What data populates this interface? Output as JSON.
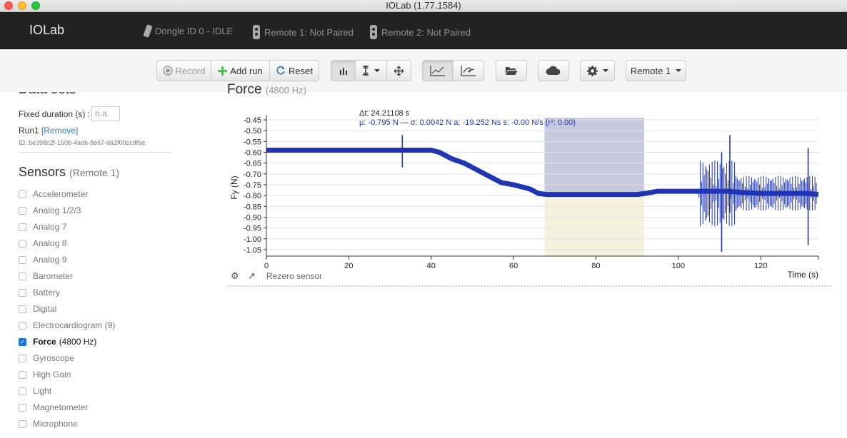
{
  "window": {
    "title": "IOLab (1.77.1584)"
  },
  "navbar": {
    "brand": "IOLab",
    "dongle": "Dongle ID 0 - IDLE",
    "remote1": "Remote 1: Not Paired",
    "remote2": "Remote 2: Not Paired"
  },
  "toolbar": {
    "record": "Record",
    "add_run": "Add run",
    "reset": "Reset",
    "remote_select": "Remote 1"
  },
  "sidebar": {
    "data_sets_title": "Data sets",
    "fixed_duration_label": "Fixed duration (s) :",
    "fixed_duration_placeholder": "n.a.",
    "run_name": "Run1",
    "run_remove": "[Remove]",
    "run_id": "ID: be398c2f-150b-4ad6-8e67-da3f00ccdf6e",
    "sensors_title": "Sensors",
    "sensors_subtitle": "(Remote 1)",
    "sensors": [
      {
        "name": "Accelerometer",
        "checked": false
      },
      {
        "name": "Analog 1/2/3",
        "checked": false
      },
      {
        "name": "Analog 7",
        "checked": false
      },
      {
        "name": "Analog 8",
        "checked": false
      },
      {
        "name": "Analog 9",
        "checked": false
      },
      {
        "name": "Barometer",
        "checked": false
      },
      {
        "name": "Battery",
        "checked": false
      },
      {
        "name": "Digital",
        "checked": false
      },
      {
        "name": "Electrocardiogram (9)",
        "checked": false
      },
      {
        "name": "Force",
        "rate": "(4800 Hz)",
        "checked": true
      },
      {
        "name": "Gyroscope",
        "checked": false
      },
      {
        "name": "High Gain",
        "checked": false
      },
      {
        "name": "Light",
        "checked": false
      },
      {
        "name": "Magnetometer",
        "checked": false
      },
      {
        "name": "Microphone",
        "checked": false
      }
    ]
  },
  "plot": {
    "title": "Force",
    "rate": "(4800 Hz)",
    "stats_dt": "Δt: 24.21108 s",
    "stats_line": "μ: -0.795 N — σ: 0.0042 N   a: -19.252 Ns   s: -0.00 N/s (r²: 0.00)",
    "y_axis_label": "Fy (N)",
    "x_axis_label": "Time (s)",
    "rezero": "Rezero sensor",
    "colors": {
      "trace": "#1f35b8",
      "selection_top": "#c7c9dc",
      "selection_bottom": "#f5f1dc"
    }
  },
  "chart_data": {
    "type": "line",
    "xlabel": "Time (s)",
    "ylabel": "Fy (N)",
    "xlim": [
      0,
      134
    ],
    "ylim": [
      -1.08,
      -0.44
    ],
    "xticks": [
      0,
      20,
      40,
      60,
      80,
      100,
      120
    ],
    "yticks": [
      -0.45,
      -0.5,
      -0.55,
      -0.6,
      -0.65,
      -0.7,
      -0.75,
      -0.8,
      -0.85,
      -0.9,
      -0.95,
      -1.0,
      -1.05
    ],
    "ytick_labels": [
      "-0.45",
      "-0.50",
      "-0.55",
      "-0.60",
      "-0.65",
      "-0.70",
      "-0.75",
      "-0.80",
      "-0.85",
      "-0.90",
      "-0.95",
      "-1.00",
      "-1.05"
    ],
    "selection": {
      "x_start": 67.5,
      "x_end": 91.7
    },
    "series": [
      {
        "x": [
          0,
          5,
          10,
          15,
          20,
          25,
          30,
          32,
          33,
          34,
          38,
          40,
          42,
          45,
          48,
          50,
          52,
          55,
          57,
          60,
          62,
          64,
          66,
          68,
          70,
          75,
          80,
          85,
          90,
          92,
          95,
          100,
          105,
          108,
          110,
          111,
          112,
          115,
          120,
          125,
          130,
          131,
          134
        ],
        "y": [
          -0.59,
          -0.59,
          -0.59,
          -0.59,
          -0.59,
          -0.59,
          -0.59,
          -0.59,
          -0.59,
          -0.59,
          -0.59,
          -0.59,
          -0.6,
          -0.63,
          -0.65,
          -0.67,
          -0.69,
          -0.72,
          -0.74,
          -0.75,
          -0.76,
          -0.77,
          -0.79,
          -0.795,
          -0.795,
          -0.795,
          -0.795,
          -0.795,
          -0.795,
          -0.79,
          -0.78,
          -0.78,
          -0.78,
          -0.78,
          -0.78,
          -0.78,
          -0.78,
          -0.785,
          -0.79,
          -0.79,
          -0.79,
          -0.79,
          -0.795
        ]
      }
    ],
    "spikes": [
      {
        "x": 33,
        "ymin": -0.67,
        "ymax": -0.52
      },
      {
        "x": 110.5,
        "ymin": -1.06,
        "ymax": -0.6
      },
      {
        "x": 112.5,
        "ymin": -0.88,
        "ymax": -0.52
      },
      {
        "x": 131.5,
        "ymin": -1.03,
        "ymax": -0.58
      }
    ]
  }
}
